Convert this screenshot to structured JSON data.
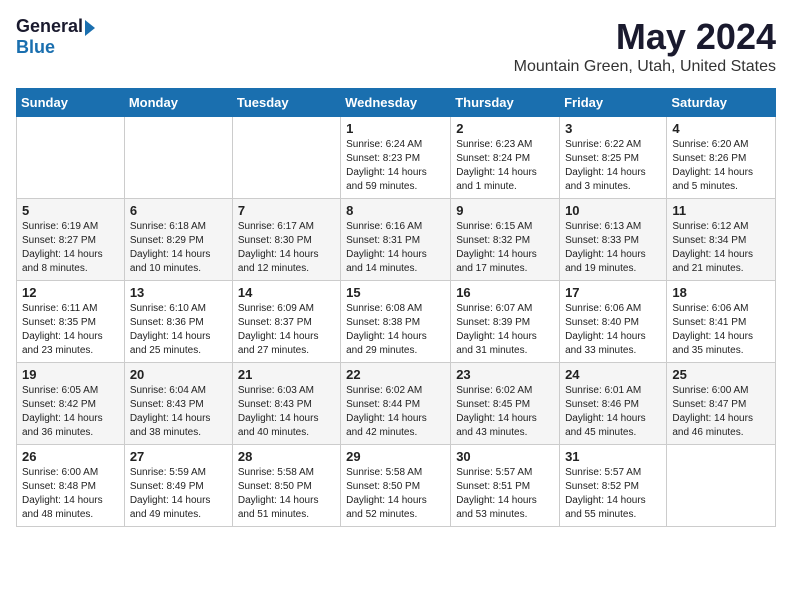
{
  "logo": {
    "general": "General",
    "blue": "Blue"
  },
  "title": "May 2024",
  "location": "Mountain Green, Utah, United States",
  "days_of_week": [
    "Sunday",
    "Monday",
    "Tuesday",
    "Wednesday",
    "Thursday",
    "Friday",
    "Saturday"
  ],
  "weeks": [
    [
      {
        "day": "",
        "sunrise": "",
        "sunset": "",
        "daylight": ""
      },
      {
        "day": "",
        "sunrise": "",
        "sunset": "",
        "daylight": ""
      },
      {
        "day": "",
        "sunrise": "",
        "sunset": "",
        "daylight": ""
      },
      {
        "day": "1",
        "sunrise": "Sunrise: 6:24 AM",
        "sunset": "Sunset: 8:23 PM",
        "daylight": "Daylight: 14 hours and 59 minutes."
      },
      {
        "day": "2",
        "sunrise": "Sunrise: 6:23 AM",
        "sunset": "Sunset: 8:24 PM",
        "daylight": "Daylight: 14 hours and 1 minute."
      },
      {
        "day": "3",
        "sunrise": "Sunrise: 6:22 AM",
        "sunset": "Sunset: 8:25 PM",
        "daylight": "Daylight: 14 hours and 3 minutes."
      },
      {
        "day": "4",
        "sunrise": "Sunrise: 6:20 AM",
        "sunset": "Sunset: 8:26 PM",
        "daylight": "Daylight: 14 hours and 5 minutes."
      }
    ],
    [
      {
        "day": "5",
        "sunrise": "Sunrise: 6:19 AM",
        "sunset": "Sunset: 8:27 PM",
        "daylight": "Daylight: 14 hours and 8 minutes."
      },
      {
        "day": "6",
        "sunrise": "Sunrise: 6:18 AM",
        "sunset": "Sunset: 8:29 PM",
        "daylight": "Daylight: 14 hours and 10 minutes."
      },
      {
        "day": "7",
        "sunrise": "Sunrise: 6:17 AM",
        "sunset": "Sunset: 8:30 PM",
        "daylight": "Daylight: 14 hours and 12 minutes."
      },
      {
        "day": "8",
        "sunrise": "Sunrise: 6:16 AM",
        "sunset": "Sunset: 8:31 PM",
        "daylight": "Daylight: 14 hours and 14 minutes."
      },
      {
        "day": "9",
        "sunrise": "Sunrise: 6:15 AM",
        "sunset": "Sunset: 8:32 PM",
        "daylight": "Daylight: 14 hours and 17 minutes."
      },
      {
        "day": "10",
        "sunrise": "Sunrise: 6:13 AM",
        "sunset": "Sunset: 8:33 PM",
        "daylight": "Daylight: 14 hours and 19 minutes."
      },
      {
        "day": "11",
        "sunrise": "Sunrise: 6:12 AM",
        "sunset": "Sunset: 8:34 PM",
        "daylight": "Daylight: 14 hours and 21 minutes."
      }
    ],
    [
      {
        "day": "12",
        "sunrise": "Sunrise: 6:11 AM",
        "sunset": "Sunset: 8:35 PM",
        "daylight": "Daylight: 14 hours and 23 minutes."
      },
      {
        "day": "13",
        "sunrise": "Sunrise: 6:10 AM",
        "sunset": "Sunset: 8:36 PM",
        "daylight": "Daylight: 14 hours and 25 minutes."
      },
      {
        "day": "14",
        "sunrise": "Sunrise: 6:09 AM",
        "sunset": "Sunset: 8:37 PM",
        "daylight": "Daylight: 14 hours and 27 minutes."
      },
      {
        "day": "15",
        "sunrise": "Sunrise: 6:08 AM",
        "sunset": "Sunset: 8:38 PM",
        "daylight": "Daylight: 14 hours and 29 minutes."
      },
      {
        "day": "16",
        "sunrise": "Sunrise: 6:07 AM",
        "sunset": "Sunset: 8:39 PM",
        "daylight": "Daylight: 14 hours and 31 minutes."
      },
      {
        "day": "17",
        "sunrise": "Sunrise: 6:06 AM",
        "sunset": "Sunset: 8:40 PM",
        "daylight": "Daylight: 14 hours and 33 minutes."
      },
      {
        "day": "18",
        "sunrise": "Sunrise: 6:06 AM",
        "sunset": "Sunset: 8:41 PM",
        "daylight": "Daylight: 14 hours and 35 minutes."
      }
    ],
    [
      {
        "day": "19",
        "sunrise": "Sunrise: 6:05 AM",
        "sunset": "Sunset: 8:42 PM",
        "daylight": "Daylight: 14 hours and 36 minutes."
      },
      {
        "day": "20",
        "sunrise": "Sunrise: 6:04 AM",
        "sunset": "Sunset: 8:43 PM",
        "daylight": "Daylight: 14 hours and 38 minutes."
      },
      {
        "day": "21",
        "sunrise": "Sunrise: 6:03 AM",
        "sunset": "Sunset: 8:43 PM",
        "daylight": "Daylight: 14 hours and 40 minutes."
      },
      {
        "day": "22",
        "sunrise": "Sunrise: 6:02 AM",
        "sunset": "Sunset: 8:44 PM",
        "daylight": "Daylight: 14 hours and 42 minutes."
      },
      {
        "day": "23",
        "sunrise": "Sunrise: 6:02 AM",
        "sunset": "Sunset: 8:45 PM",
        "daylight": "Daylight: 14 hours and 43 minutes."
      },
      {
        "day": "24",
        "sunrise": "Sunrise: 6:01 AM",
        "sunset": "Sunset: 8:46 PM",
        "daylight": "Daylight: 14 hours and 45 minutes."
      },
      {
        "day": "25",
        "sunrise": "Sunrise: 6:00 AM",
        "sunset": "Sunset: 8:47 PM",
        "daylight": "Daylight: 14 hours and 46 minutes."
      }
    ],
    [
      {
        "day": "26",
        "sunrise": "Sunrise: 6:00 AM",
        "sunset": "Sunset: 8:48 PM",
        "daylight": "Daylight: 14 hours and 48 minutes."
      },
      {
        "day": "27",
        "sunrise": "Sunrise: 5:59 AM",
        "sunset": "Sunset: 8:49 PM",
        "daylight": "Daylight: 14 hours and 49 minutes."
      },
      {
        "day": "28",
        "sunrise": "Sunrise: 5:58 AM",
        "sunset": "Sunset: 8:50 PM",
        "daylight": "Daylight: 14 hours and 51 minutes."
      },
      {
        "day": "29",
        "sunrise": "Sunrise: 5:58 AM",
        "sunset": "Sunset: 8:50 PM",
        "daylight": "Daylight: 14 hours and 52 minutes."
      },
      {
        "day": "30",
        "sunrise": "Sunrise: 5:57 AM",
        "sunset": "Sunset: 8:51 PM",
        "daylight": "Daylight: 14 hours and 53 minutes."
      },
      {
        "day": "31",
        "sunrise": "Sunrise: 5:57 AM",
        "sunset": "Sunset: 8:52 PM",
        "daylight": "Daylight: 14 hours and 55 minutes."
      },
      {
        "day": "",
        "sunrise": "",
        "sunset": "",
        "daylight": ""
      }
    ]
  ]
}
